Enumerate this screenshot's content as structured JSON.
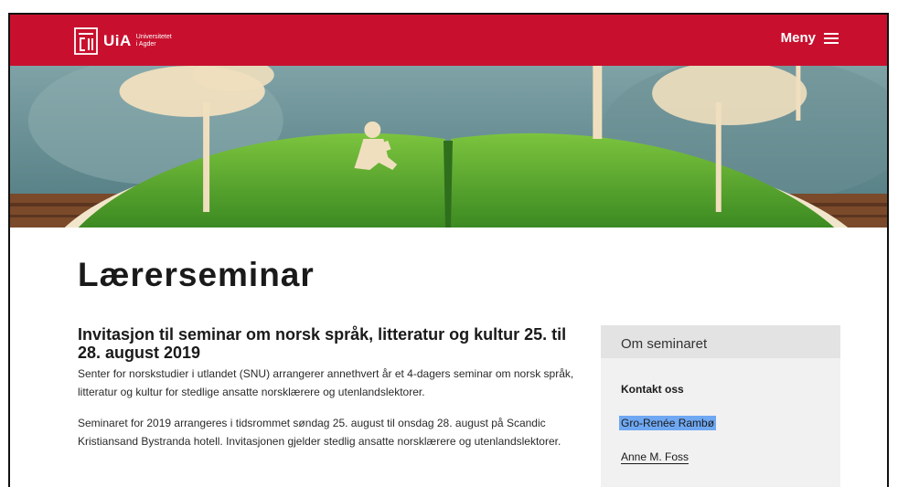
{
  "header": {
    "logo_text": "UiA",
    "logo_sub_line1": "Universitetet",
    "logo_sub_line2": "i Agder",
    "menu_label": "Meny",
    "brand_color": "#c8102e"
  },
  "page": {
    "title": "Lærerseminar"
  },
  "main": {
    "heading": "Invitasjon til seminar om norsk språk, litteratur og kultur 25. til 28. august 2019",
    "paragraph1": "Senter for norskstudier i utlandet (SNU) arrangerer annethvert år et 4-dagers seminar om norsk språk, litteratur og kultur for stedlige ansatte norsklærere og utenlandslektorer.",
    "paragraph2": "Seminaret for 2019 arrangeres i tidsrommet søndag 25. august til onsdag 28. august på Scandic Kristiansand Bystranda hotell. Invitasjonen gjelder stedlig ansatte norsklærere og utenlandslektorer."
  },
  "sidebar": {
    "title": "Om seminaret",
    "contact_heading": "Kontakt oss",
    "contacts": [
      "Gro-Renée Rambø",
      "Anne M. Foss"
    ],
    "highlight_color": "#6fa8f2"
  },
  "icons": {
    "logo": "uia-logo-icon",
    "menu": "hamburger-menu-icon"
  }
}
